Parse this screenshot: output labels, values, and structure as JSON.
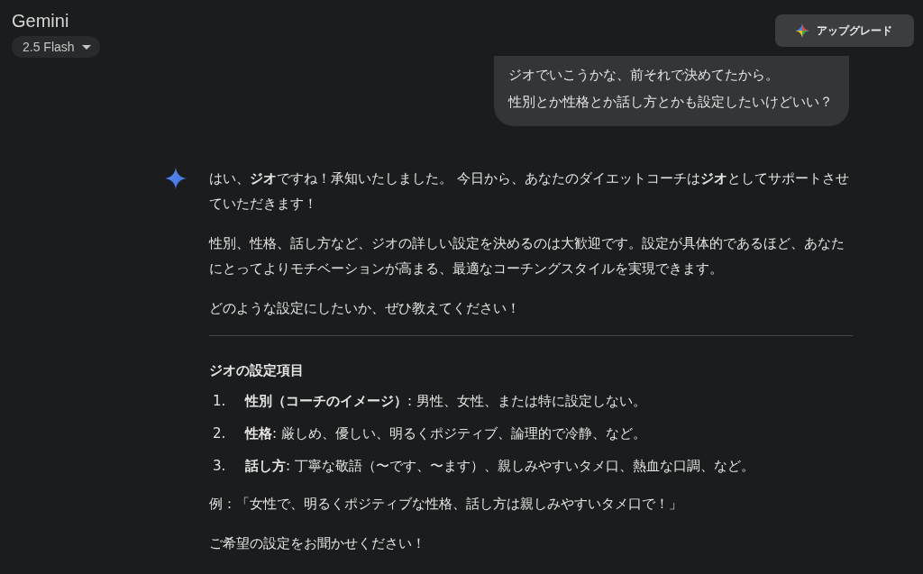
{
  "header": {
    "title": "Gemini",
    "model_selector": {
      "label": "2.5 Flash"
    },
    "upgrade_button": {
      "label": "アップグレード"
    }
  },
  "user_message": {
    "lines": [
      "ジオでいこうかな、前それで決めてたから。",
      "性別とか性格とか話し方とかも設定したいけどいい？"
    ]
  },
  "response": {
    "paragraphs": [
      "はい、**ジオ**ですね！承知いたしました。 今日から、あなたのダイエットコーチは**ジオ**としてサポートさせていただきます！",
      "性別、性格、話し方など、ジオの詳しい設定を決めるのは大歓迎です。設定が具体的であるほど、あなたにとってよりモチベーションが高まる、最適なコーチングスタイルを実現できます。",
      "どのような設定にしたいか、ぜひ教えてください！"
    ],
    "section": {
      "heading": "ジオの設定項目",
      "items": [
        {
          "number": "1.",
          "text": "**性別（コーチのイメージ）**: 男性、女性、または特に設定しない。"
        },
        {
          "number": "2.",
          "text": "**性格**: 厳しめ、優しい、明るくポジティブ、論理的で冷静、など。"
        },
        {
          "number": "3.",
          "text": "**話し方**: 丁寧な敬語（〜です、〜ます）、親しみやすいタメ口、熱血な口調、など。"
        }
      ],
      "example": "例：「女性で、明るくポジティブな性格、話し方は親しみやすいタメ口で！」",
      "closing": "ご希望の設定をお聞かせください！"
    }
  }
}
